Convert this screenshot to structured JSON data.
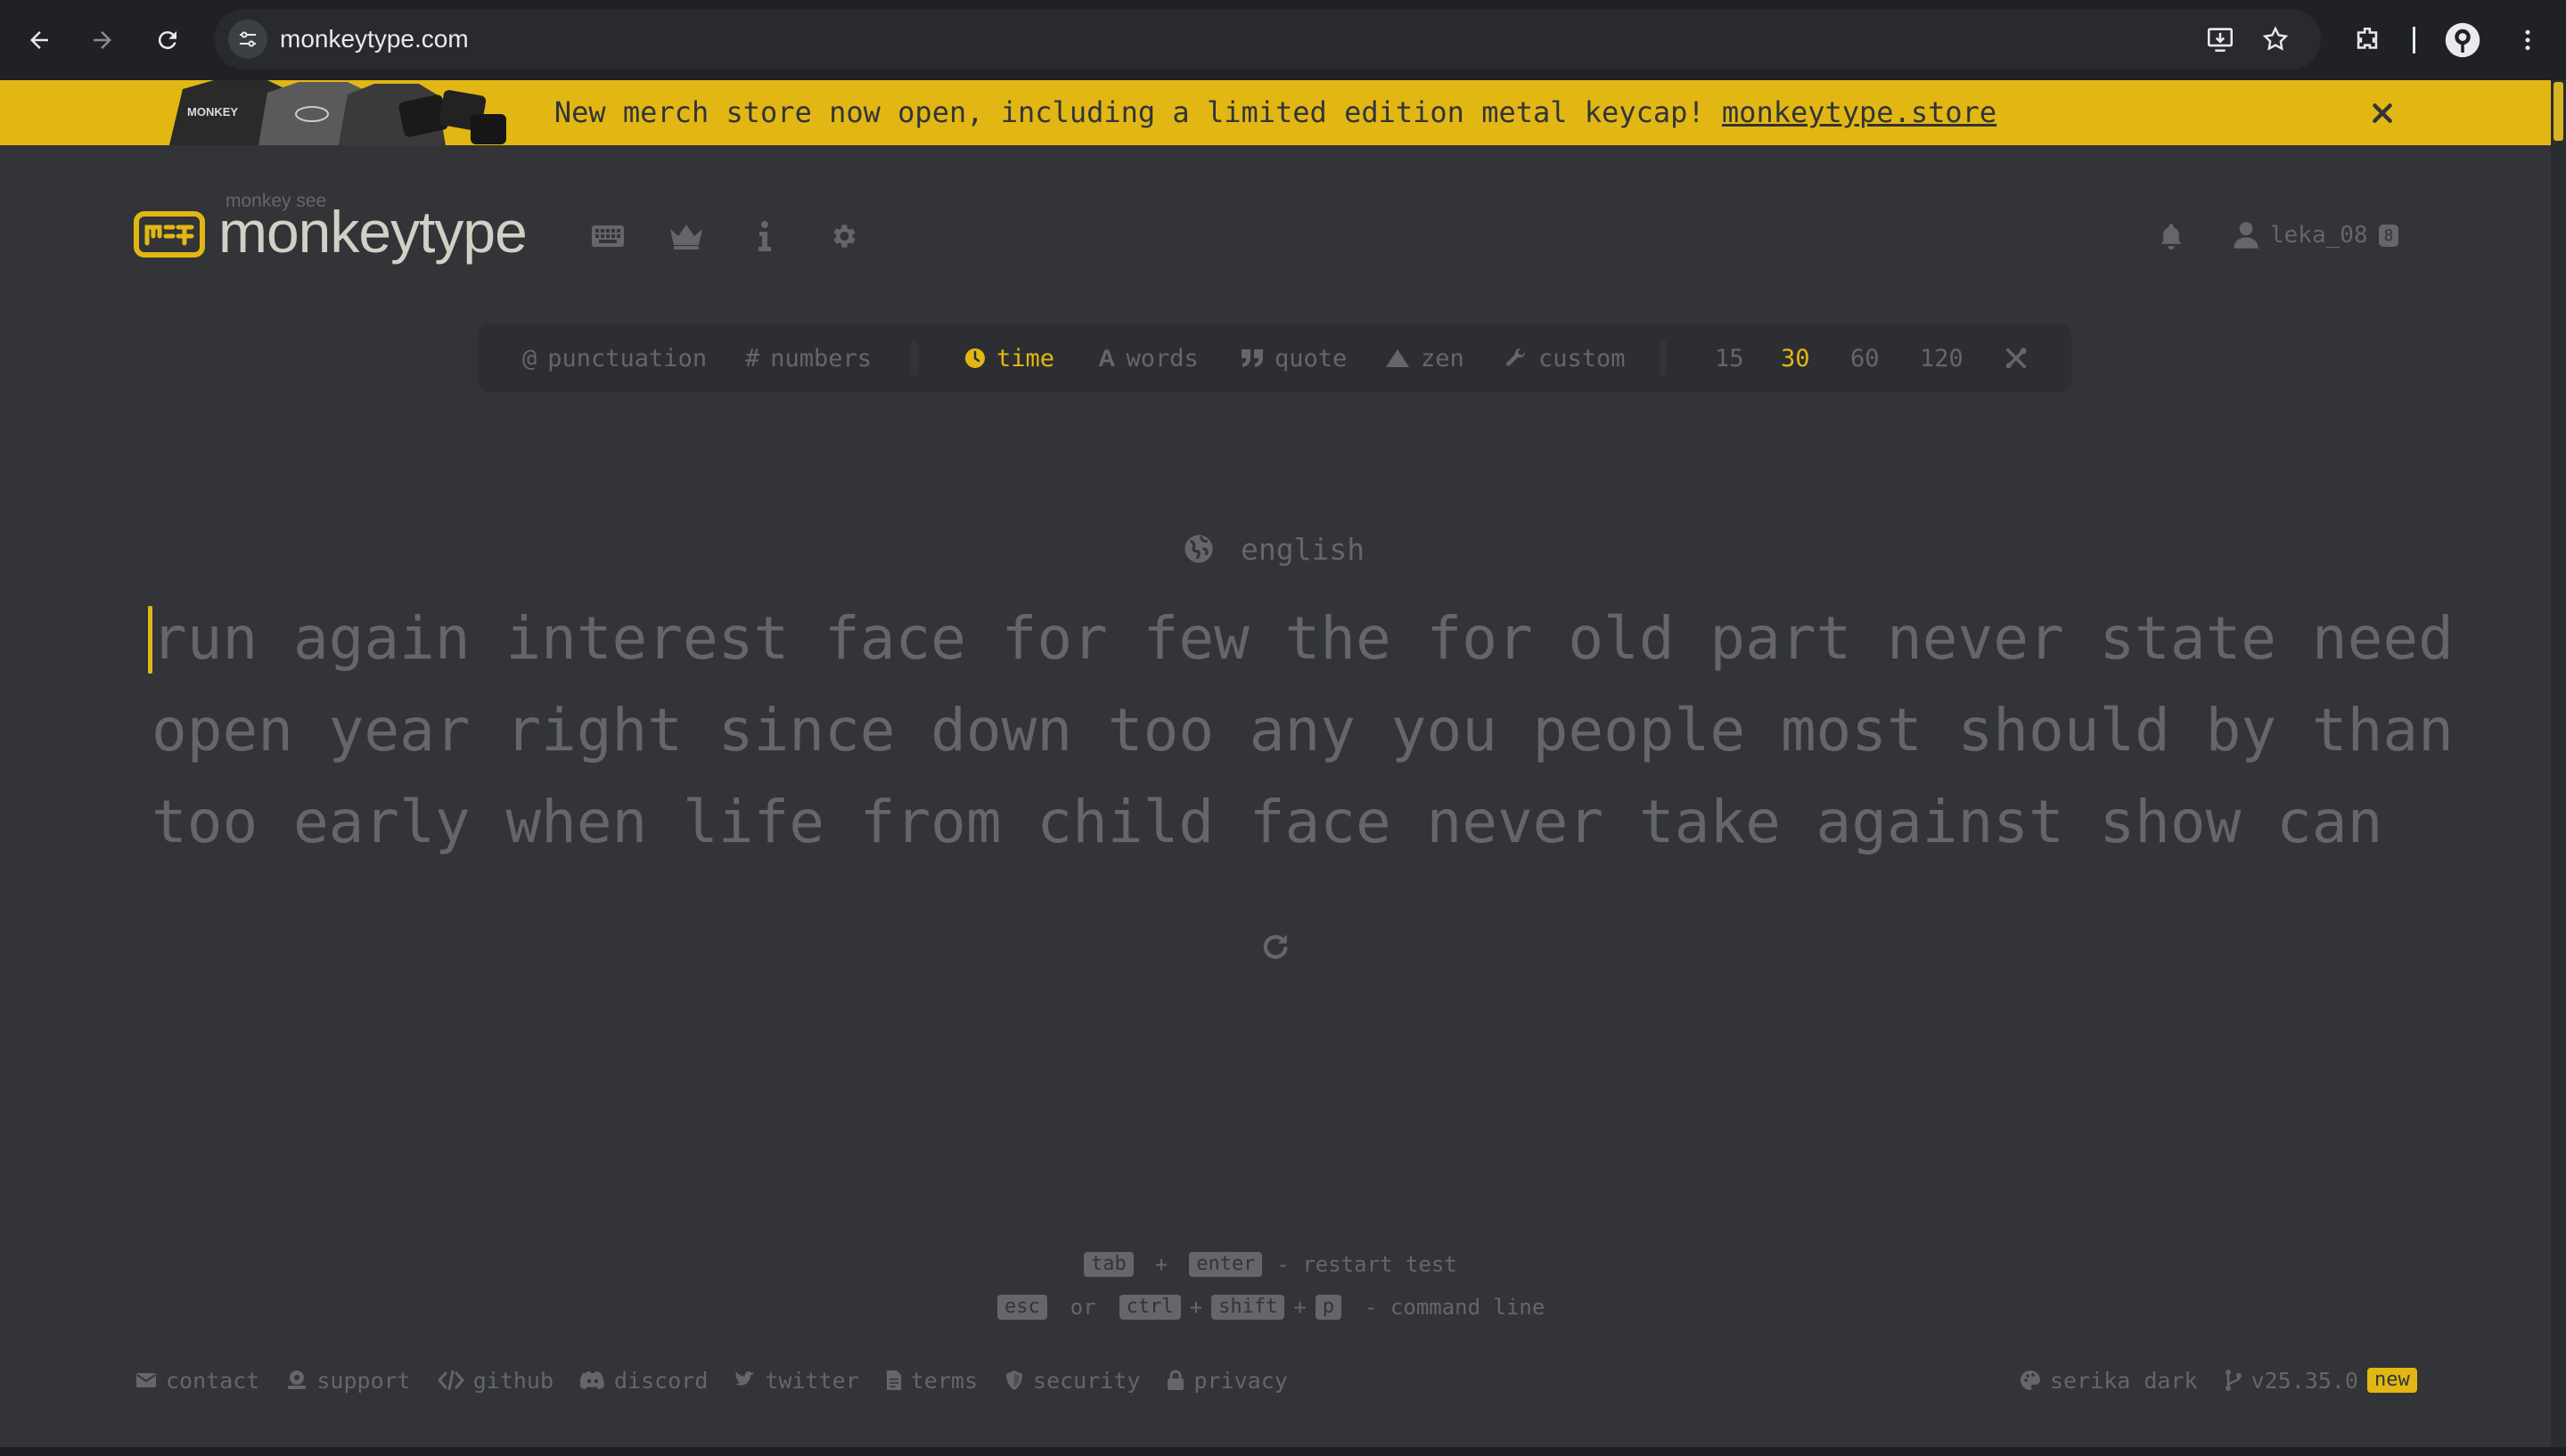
{
  "browser": {
    "url": "monkeytype.com",
    "back_icon": "arrow-left-icon",
    "forward_icon": "arrow-right-icon",
    "reload_icon": "reload-icon"
  },
  "banner": {
    "text": "New merch store now open, including a limited edition metal keycap! ",
    "link": "monkeytype.store",
    "thumb_text": "MONKEY",
    "close_icon": "close-icon",
    "color": "#e2b714"
  },
  "header": {
    "logo_small": "monkey see",
    "logo_text": "monkeytype",
    "user": {
      "name": "leka_08",
      "level": "8"
    }
  },
  "config": {
    "punctuation": "punctuation",
    "numbers": "numbers",
    "modes": [
      "time",
      "words",
      "quote",
      "zen",
      "custom"
    ],
    "active_mode": "time",
    "times": [
      "15",
      "30",
      "60",
      "120"
    ],
    "active_time": "30"
  },
  "test": {
    "language": "english",
    "lines": [
      "run again interest face for few the for old part never state need",
      "open year right since down too any you people most should by than",
      "too early when life from child face never take against show can"
    ]
  },
  "hints": {
    "tab": "tab",
    "plus": "+",
    "enter": "enter",
    "restart_label": "- restart test",
    "esc": "esc",
    "or": "or",
    "ctrl": "ctrl",
    "shift": "shift",
    "p": "p",
    "command_label": "- command line"
  },
  "footer": {
    "links": [
      "contact",
      "support",
      "github",
      "discord",
      "twitter",
      "terms",
      "security",
      "privacy"
    ],
    "theme": "serika dark",
    "version": "v25.35.0",
    "new_badge": "new"
  },
  "colors": {
    "background": "#323437",
    "main": "#e2b714",
    "sub": "#646669",
    "text": "#d1d0c5",
    "sub_alt": "#2c2e31"
  }
}
